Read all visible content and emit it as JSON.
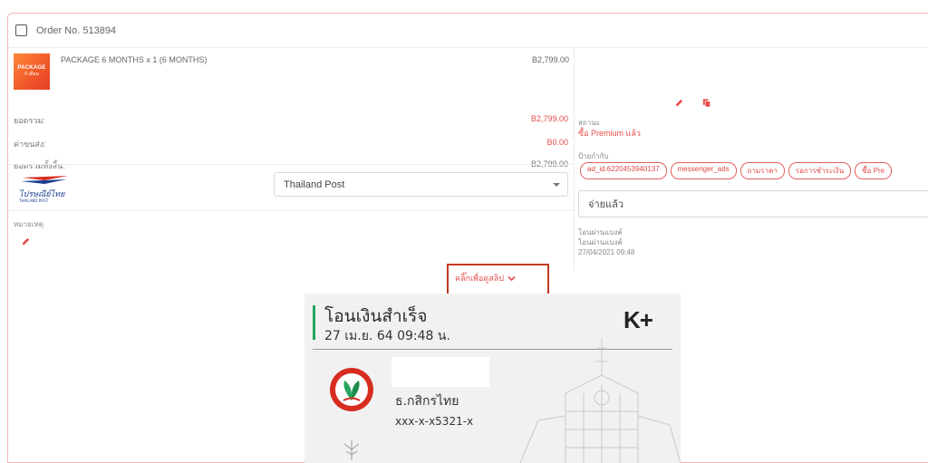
{
  "order": {
    "number_label": "Order No. 513894"
  },
  "product": {
    "thumb_line1": "PACKAGE",
    "thumb_line2": "6 เดือน",
    "name": "PACKAGE 6 MONTHS x 1 (6 MONTHS)",
    "price": "B2,799.00"
  },
  "summary": [
    {
      "label": "ยอดรวม:",
      "value": "B2,799.00",
      "tone": "red"
    },
    {
      "label": "ค่าขนส่ง:",
      "value": "B0.00",
      "tone": "red"
    },
    {
      "label": "ยอดรวมทั้งสิ้น:",
      "value": "B2,799.00",
      "tone": "grey"
    }
  ],
  "shipping": {
    "carrier_logo_text": "ไปรษณีย์ไทย",
    "carrier_logo_sub": "THAILAND POST",
    "selected": "Thailand Post"
  },
  "note": {
    "label": "หมายเหตุ"
  },
  "status": {
    "label": "สถานะ",
    "value": "ซื้อ Premium แล้ว"
  },
  "tags": {
    "label": "ป้ายกำกับ",
    "items": [
      "ad_id.6220453940137",
      "messenger_ads",
      "ถามราคา",
      "รอการชำระเงิน",
      "ซื้อ Pre"
    ]
  },
  "payment": {
    "status_value": "จ่ายแล้ว",
    "method_line1": "โอนผ่านแบงค์",
    "method_line2": "โอนผ่านแบงค์",
    "datetime": "27/04/2021 09:48"
  },
  "slip_toggle": {
    "label": "คลิ๊กเพื่อดูสลิป"
  },
  "slip": {
    "title": "โอนเงินสำเร็จ",
    "datetime": "27 เม.ย. 64  09:48 น.",
    "brand": "K+",
    "bank_name": "ธ.กสิกรไทย",
    "account": "xxx-x-x5321-x"
  },
  "colors": {
    "accent_red": "#e64b4b",
    "card_border": "#f4b8b8",
    "highlight_box": "#c0391f",
    "kbank_green": "#25a55f",
    "kbank_red": "#d62d20"
  },
  "icons": [
    "edit-pencil-icon",
    "copy-icon",
    "chevron-down-icon",
    "select-caret-icon"
  ]
}
